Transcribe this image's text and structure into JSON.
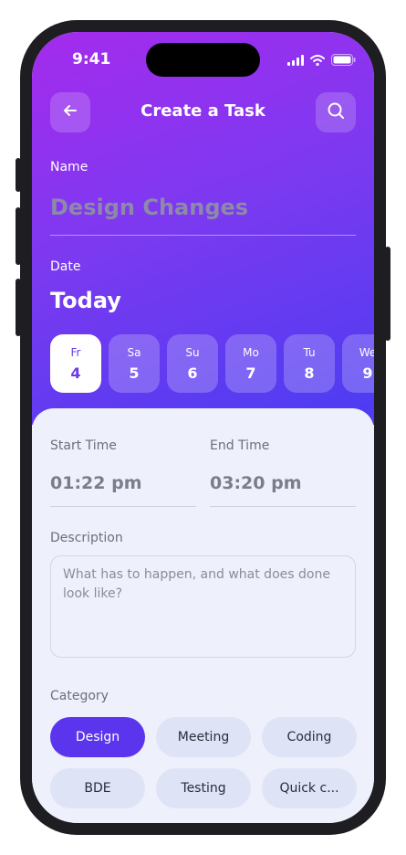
{
  "status_bar": {
    "time": "9:41"
  },
  "header": {
    "title": "Create a Task",
    "back_icon": "arrow-left-icon",
    "search_icon": "search-icon"
  },
  "name": {
    "label": "Name",
    "value": "Design Changes"
  },
  "date": {
    "label": "Date",
    "heading": "Today",
    "days": [
      {
        "name": "Fr",
        "num": "4",
        "selected": true
      },
      {
        "name": "Sa",
        "num": "5"
      },
      {
        "name": "Su",
        "num": "6"
      },
      {
        "name": "Mo",
        "num": "7"
      },
      {
        "name": "Tu",
        "num": "8"
      },
      {
        "name": "We",
        "num": "9"
      }
    ]
  },
  "time": {
    "start_label": "Start Time",
    "start_value": "01:22 pm",
    "end_label": "End Time",
    "end_value": "03:20 pm"
  },
  "description": {
    "label": "Description",
    "placeholder": "What has to happen, and what does done look like?"
  },
  "category": {
    "label": "Category",
    "items": [
      {
        "label": "Design",
        "selected": true
      },
      {
        "label": "Meeting"
      },
      {
        "label": "Coding"
      },
      {
        "label": "BDE"
      },
      {
        "label": "Testing"
      },
      {
        "label": "Quick c..."
      }
    ]
  },
  "colors": {
    "accent": "#5b35ee",
    "gradient_start": "#a52bee",
    "gradient_end": "#4b3cf2",
    "sheet_bg": "#eef0fb"
  }
}
